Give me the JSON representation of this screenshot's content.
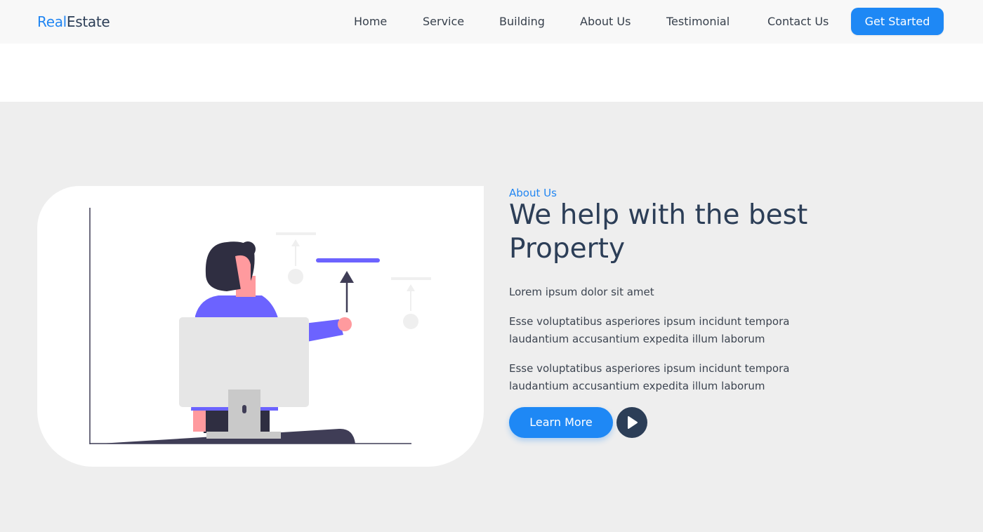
{
  "brand": {
    "part1": "Real",
    "part2": "Estate"
  },
  "nav": {
    "items": [
      "Home",
      "Service",
      "Building",
      "About Us",
      "Testimonial",
      "Contact Us"
    ],
    "cta_label": "Get Started"
  },
  "about": {
    "eyebrow": "About Us",
    "heading": "We help with the best Property",
    "intro": "Lorem ipsum dolor sit amet",
    "paragraph_1": "Esse voluptatibus asperiores ipsum incidunt tempora laudantium accusantium expedita illum laborum",
    "paragraph_2": "Esse voluptatibus asperiores ipsum incidunt tempora laudantium accusantium expedita illum laborum",
    "learn_more_label": "Learn More",
    "play_icon": "play-icon"
  },
  "colors": {
    "accent": "#1e88f5",
    "heading": "#2c3e57",
    "section_bg": "#eeeeee",
    "illustration_purple": "#6c63ff"
  }
}
